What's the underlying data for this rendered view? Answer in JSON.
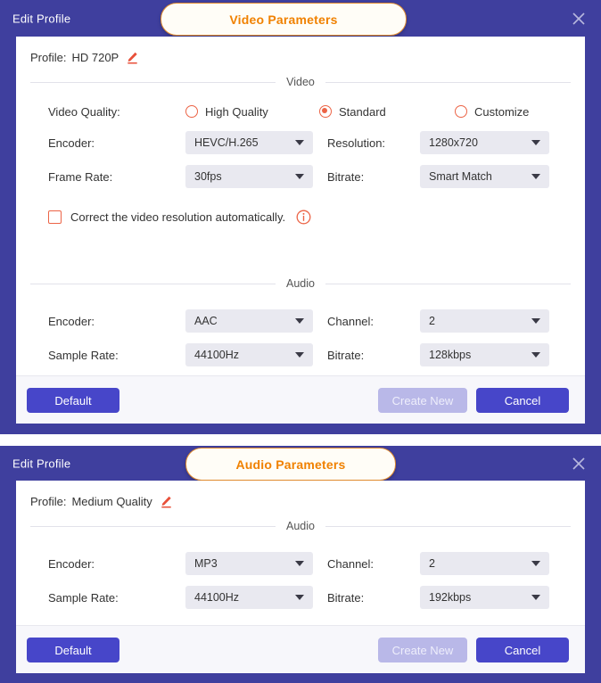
{
  "theme": {
    "dialog_bg": "#3f3f9e",
    "accent_orange": "#f08100",
    "accent_red": "#ec6446",
    "button_primary": "#4746c9",
    "button_disabled": "#b9b8e8",
    "select_bg": "#e9e9f0"
  },
  "video_dialog": {
    "window_title": "Edit Profile",
    "tab_label": "Video Parameters",
    "close_icon": "close-icon",
    "profile": {
      "label": "Profile:",
      "value": "HD 720P",
      "edit_icon": "pencil-icon"
    },
    "video_section": {
      "caption": "Video",
      "quality": {
        "label": "Video Quality:",
        "options": [
          {
            "label": "High Quality",
            "selected": false
          },
          {
            "label": "Standard",
            "selected": true
          },
          {
            "label": "Customize",
            "selected": false
          }
        ]
      },
      "fields": [
        {
          "label": "Encoder:",
          "value": "HEVC/H.265"
        },
        {
          "label": "Resolution:",
          "value": "1280x720"
        },
        {
          "label": "Frame Rate:",
          "value": "30fps"
        },
        {
          "label": "Bitrate:",
          "value": "Smart Match"
        }
      ],
      "auto_correct": {
        "label": "Correct the video resolution automatically.",
        "checked": false,
        "info_icon": "info-icon"
      }
    },
    "audio_section": {
      "caption": "Audio",
      "fields": [
        {
          "label": "Encoder:",
          "value": "AAC"
        },
        {
          "label": "Channel:",
          "value": "2"
        },
        {
          "label": "Sample Rate:",
          "value": "44100Hz"
        },
        {
          "label": "Bitrate:",
          "value": "128kbps"
        }
      ]
    },
    "footer": {
      "default_label": "Default",
      "create_new_label": "Create New",
      "cancel_label": "Cancel"
    }
  },
  "audio_dialog": {
    "window_title": "Edit Profile",
    "tab_label": "Audio Parameters",
    "close_icon": "close-icon",
    "profile": {
      "label": "Profile:",
      "value": "Medium Quality",
      "edit_icon": "pencil-icon"
    },
    "audio_section": {
      "caption": "Audio",
      "fields": [
        {
          "label": "Encoder:",
          "value": "MP3"
        },
        {
          "label": "Channel:",
          "value": "2"
        },
        {
          "label": "Sample Rate:",
          "value": "44100Hz"
        },
        {
          "label": "Bitrate:",
          "value": "192kbps"
        }
      ]
    },
    "footer": {
      "default_label": "Default",
      "create_new_label": "Create New",
      "cancel_label": "Cancel"
    }
  }
}
